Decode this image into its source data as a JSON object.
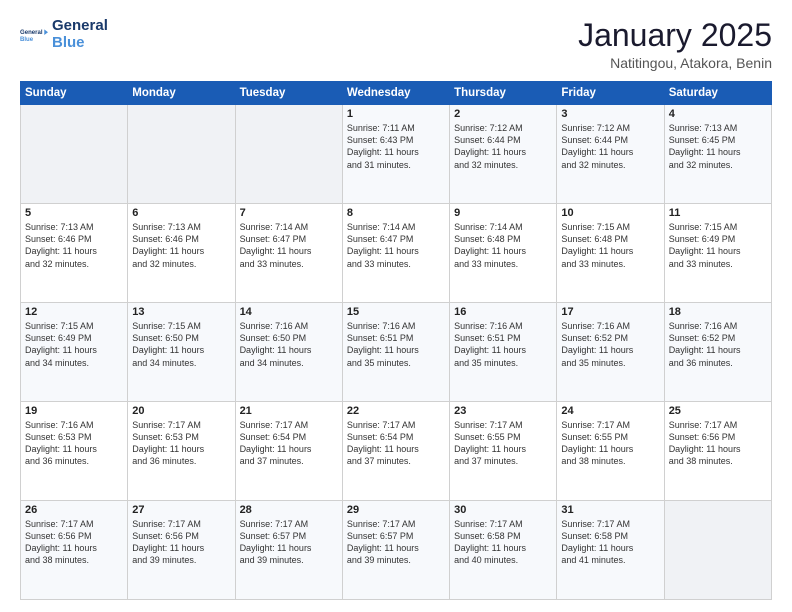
{
  "logo": {
    "line1": "General",
    "line2": "Blue"
  },
  "header": {
    "month": "January 2025",
    "location": "Natitingou, Atakora, Benin"
  },
  "days_of_week": [
    "Sunday",
    "Monday",
    "Tuesday",
    "Wednesday",
    "Thursday",
    "Friday",
    "Saturday"
  ],
  "weeks": [
    [
      {
        "day": "",
        "content": ""
      },
      {
        "day": "",
        "content": ""
      },
      {
        "day": "",
        "content": ""
      },
      {
        "day": "1",
        "content": "Sunrise: 7:11 AM\nSunset: 6:43 PM\nDaylight: 11 hours\nand 31 minutes."
      },
      {
        "day": "2",
        "content": "Sunrise: 7:12 AM\nSunset: 6:44 PM\nDaylight: 11 hours\nand 32 minutes."
      },
      {
        "day": "3",
        "content": "Sunrise: 7:12 AM\nSunset: 6:44 PM\nDaylight: 11 hours\nand 32 minutes."
      },
      {
        "day": "4",
        "content": "Sunrise: 7:13 AM\nSunset: 6:45 PM\nDaylight: 11 hours\nand 32 minutes."
      }
    ],
    [
      {
        "day": "5",
        "content": "Sunrise: 7:13 AM\nSunset: 6:46 PM\nDaylight: 11 hours\nand 32 minutes."
      },
      {
        "day": "6",
        "content": "Sunrise: 7:13 AM\nSunset: 6:46 PM\nDaylight: 11 hours\nand 32 minutes."
      },
      {
        "day": "7",
        "content": "Sunrise: 7:14 AM\nSunset: 6:47 PM\nDaylight: 11 hours\nand 33 minutes."
      },
      {
        "day": "8",
        "content": "Sunrise: 7:14 AM\nSunset: 6:47 PM\nDaylight: 11 hours\nand 33 minutes."
      },
      {
        "day": "9",
        "content": "Sunrise: 7:14 AM\nSunset: 6:48 PM\nDaylight: 11 hours\nand 33 minutes."
      },
      {
        "day": "10",
        "content": "Sunrise: 7:15 AM\nSunset: 6:48 PM\nDaylight: 11 hours\nand 33 minutes."
      },
      {
        "day": "11",
        "content": "Sunrise: 7:15 AM\nSunset: 6:49 PM\nDaylight: 11 hours\nand 33 minutes."
      }
    ],
    [
      {
        "day": "12",
        "content": "Sunrise: 7:15 AM\nSunset: 6:49 PM\nDaylight: 11 hours\nand 34 minutes."
      },
      {
        "day": "13",
        "content": "Sunrise: 7:15 AM\nSunset: 6:50 PM\nDaylight: 11 hours\nand 34 minutes."
      },
      {
        "day": "14",
        "content": "Sunrise: 7:16 AM\nSunset: 6:50 PM\nDaylight: 11 hours\nand 34 minutes."
      },
      {
        "day": "15",
        "content": "Sunrise: 7:16 AM\nSunset: 6:51 PM\nDaylight: 11 hours\nand 35 minutes."
      },
      {
        "day": "16",
        "content": "Sunrise: 7:16 AM\nSunset: 6:51 PM\nDaylight: 11 hours\nand 35 minutes."
      },
      {
        "day": "17",
        "content": "Sunrise: 7:16 AM\nSunset: 6:52 PM\nDaylight: 11 hours\nand 35 minutes."
      },
      {
        "day": "18",
        "content": "Sunrise: 7:16 AM\nSunset: 6:52 PM\nDaylight: 11 hours\nand 36 minutes."
      }
    ],
    [
      {
        "day": "19",
        "content": "Sunrise: 7:16 AM\nSunset: 6:53 PM\nDaylight: 11 hours\nand 36 minutes."
      },
      {
        "day": "20",
        "content": "Sunrise: 7:17 AM\nSunset: 6:53 PM\nDaylight: 11 hours\nand 36 minutes."
      },
      {
        "day": "21",
        "content": "Sunrise: 7:17 AM\nSunset: 6:54 PM\nDaylight: 11 hours\nand 37 minutes."
      },
      {
        "day": "22",
        "content": "Sunrise: 7:17 AM\nSunset: 6:54 PM\nDaylight: 11 hours\nand 37 minutes."
      },
      {
        "day": "23",
        "content": "Sunrise: 7:17 AM\nSunset: 6:55 PM\nDaylight: 11 hours\nand 37 minutes."
      },
      {
        "day": "24",
        "content": "Sunrise: 7:17 AM\nSunset: 6:55 PM\nDaylight: 11 hours\nand 38 minutes."
      },
      {
        "day": "25",
        "content": "Sunrise: 7:17 AM\nSunset: 6:56 PM\nDaylight: 11 hours\nand 38 minutes."
      }
    ],
    [
      {
        "day": "26",
        "content": "Sunrise: 7:17 AM\nSunset: 6:56 PM\nDaylight: 11 hours\nand 38 minutes."
      },
      {
        "day": "27",
        "content": "Sunrise: 7:17 AM\nSunset: 6:56 PM\nDaylight: 11 hours\nand 39 minutes."
      },
      {
        "day": "28",
        "content": "Sunrise: 7:17 AM\nSunset: 6:57 PM\nDaylight: 11 hours\nand 39 minutes."
      },
      {
        "day": "29",
        "content": "Sunrise: 7:17 AM\nSunset: 6:57 PM\nDaylight: 11 hours\nand 39 minutes."
      },
      {
        "day": "30",
        "content": "Sunrise: 7:17 AM\nSunset: 6:58 PM\nDaylight: 11 hours\nand 40 minutes."
      },
      {
        "day": "31",
        "content": "Sunrise: 7:17 AM\nSunset: 6:58 PM\nDaylight: 11 hours\nand 41 minutes."
      },
      {
        "day": "",
        "content": ""
      }
    ]
  ]
}
